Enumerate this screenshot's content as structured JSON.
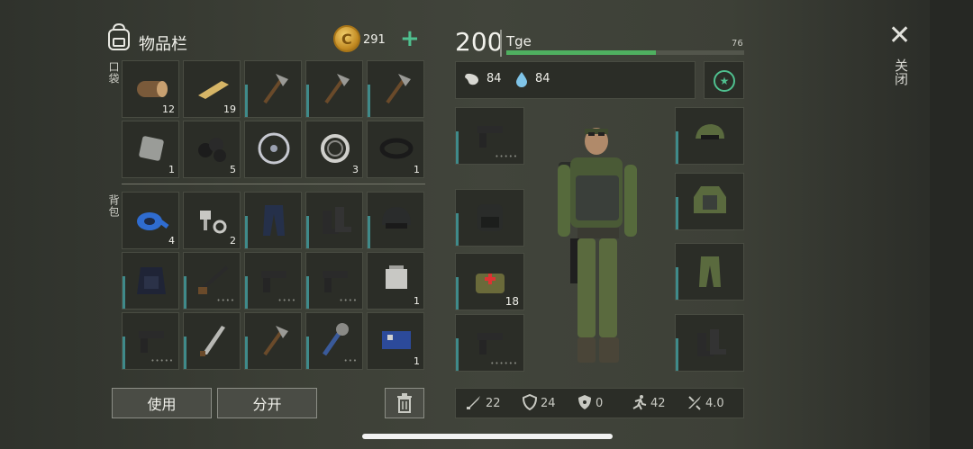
{
  "inventory": {
    "title": "物品栏",
    "coins": "291",
    "plus": "+",
    "pocket_label": "口袋",
    "backpack_label": "背包",
    "pocket_slots": [
      {
        "icon": "log-icon",
        "qty": "12",
        "dots": ""
      },
      {
        "icon": "plank-icon",
        "qty": "19",
        "dots": ""
      },
      {
        "icon": "hatchet-icon",
        "qty": "",
        "dots": "",
        "bar": true
      },
      {
        "icon": "hatchet-icon",
        "qty": "",
        "dots": "",
        "bar": true
      },
      {
        "icon": "hatchet-icon",
        "qty": "",
        "dots": "",
        "bar": true
      },
      {
        "icon": "metal-sheet-icon",
        "qty": "1",
        "dots": ""
      },
      {
        "icon": "coal-icon",
        "qty": "5",
        "dots": ""
      },
      {
        "icon": "wheel-icon",
        "qty": "",
        "dots": ""
      },
      {
        "icon": "bearing-icon",
        "qty": "3",
        "dots": ""
      },
      {
        "icon": "gasket-icon",
        "qty": "1",
        "dots": ""
      }
    ],
    "backpack_slots": [
      {
        "icon": "duct-tape-icon",
        "qty": "4",
        "dots": ""
      },
      {
        "icon": "bolts-icon",
        "qty": "2",
        "dots": ""
      },
      {
        "icon": "pants-icon",
        "qty": "",
        "dots": "",
        "bar": true
      },
      {
        "icon": "boots-icon",
        "qty": "",
        "dots": "",
        "bar": true
      },
      {
        "icon": "helmet-icon",
        "qty": "",
        "dots": "",
        "bar": true
      },
      {
        "icon": "vest-icon",
        "qty": "",
        "dots": "",
        "bar": true
      },
      {
        "icon": "shotgun-icon",
        "qty": "",
        "dots": "••••",
        "bar": true
      },
      {
        "icon": "pistol-icon",
        "qty": "",
        "dots": "••••",
        "bar": true
      },
      {
        "icon": "pistol-icon",
        "qty": "",
        "dots": "••••",
        "bar": true
      },
      {
        "icon": "engine-part-icon",
        "qty": "1",
        "dots": ""
      },
      {
        "icon": "pistol-icon",
        "qty": "",
        "dots": "•••••",
        "bar": true
      },
      {
        "icon": "machete-icon",
        "qty": "",
        "dots": "",
        "bar": true
      },
      {
        "icon": "hatchet-icon",
        "qty": "",
        "dots": "",
        "bar": true
      },
      {
        "icon": "spiked-club-icon",
        "qty": "",
        "dots": "•••",
        "bar": true
      },
      {
        "icon": "circuit-board-icon",
        "qty": "1",
        "dots": ""
      }
    ],
    "use_label": "使用",
    "split_label": "分开"
  },
  "character": {
    "health": "200",
    "name": "Tge",
    "level": "76",
    "xp_fraction": 0.63,
    "hunger": "84",
    "thirst": "84",
    "left_slots": [
      {
        "icon": "pistol-icon",
        "qty": "",
        "dots": "•••••"
      },
      {
        "icon": "backpack-icon",
        "qty": "",
        "dots": ""
      },
      {
        "icon": "medkit-bag-icon",
        "qty": "18",
        "dots": ""
      },
      {
        "icon": "pistol-icon",
        "qty": "",
        "dots": "••••••"
      }
    ],
    "right_slots": [
      {
        "icon": "camo-cap-icon"
      },
      {
        "icon": "camo-jacket-icon"
      },
      {
        "icon": "camo-pants-icon"
      },
      {
        "icon": "boots-icon"
      }
    ],
    "stats": {
      "attack": "22",
      "defense": "24",
      "radiation": "0",
      "speed": "42",
      "crit": "4.0"
    }
  },
  "close_label": "关闭",
  "colors": {
    "accent": "#4fc08f",
    "xp": "#4fb060",
    "durability": "#3f8a8a"
  }
}
